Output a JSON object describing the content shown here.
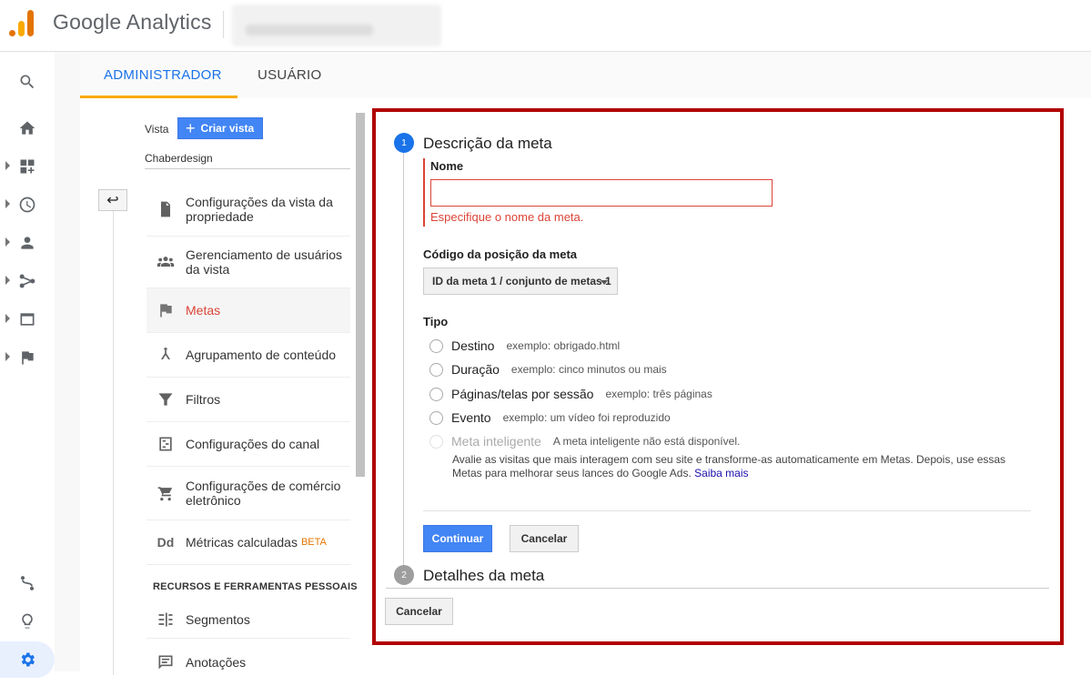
{
  "header": {
    "brand": "Google Analytics"
  },
  "rail": {
    "items": [
      "search-icon",
      "home-icon",
      "customization-icon",
      "realtime-icon",
      "audience-icon",
      "acquisition-icon",
      "behavior-icon",
      "conversions-icon",
      "attribution-icon",
      "discover-icon",
      "admin-icon"
    ]
  },
  "tabs": {
    "admin": "ADMINISTRADOR",
    "user": "USUÁRIO"
  },
  "admin_column": {
    "vista_label": "Vista",
    "criar_vista": "Criar vista",
    "view_name": "Chaberdesign",
    "menu": [
      {
        "label": "Configurações da vista da propriedade",
        "icon": "document-icon"
      },
      {
        "label": "Gerenciamento de usuários da vista",
        "icon": "users-icon"
      },
      {
        "label": "Metas",
        "icon": "flag-icon"
      },
      {
        "label": "Agrupamento de conteúdo",
        "icon": "content-grouping-icon"
      },
      {
        "label": "Filtros",
        "icon": "filter-icon"
      },
      {
        "label": "Configurações do canal",
        "icon": "channel-icon"
      },
      {
        "label": "Configurações de comércio eletrônico",
        "icon": "cart-icon"
      },
      {
        "label": "Métricas calculadas",
        "icon": "calculated-metrics-icon",
        "badge": "BETA"
      }
    ],
    "section_title": "RECURSOS E FERRAMENTAS PESSOAIS",
    "menu2": [
      {
        "label": "Segmentos",
        "icon": "segments-icon"
      },
      {
        "label": "Anotações",
        "icon": "annotations-icon"
      }
    ]
  },
  "goal": {
    "step1_number": "1",
    "step1_title": "Descrição da meta",
    "nome_label": "Nome",
    "nome_value": "",
    "nome_error": "Especifique o nome da meta.",
    "codigo_label": "Código da posição da meta",
    "codigo_value": "ID da meta 1 / conjunto de metas 1",
    "tipo_label": "Tipo",
    "types": [
      {
        "label": "Destino",
        "example": "exemplo: obrigado.html"
      },
      {
        "label": "Duração",
        "example": "exemplo: cinco minutos ou mais"
      },
      {
        "label": "Páginas/telas por sessão",
        "example": "exemplo: três páginas"
      },
      {
        "label": "Evento",
        "example": "exemplo: um vídeo foi reproduzido"
      },
      {
        "label": "Meta inteligente",
        "example": "A meta inteligente não está disponível."
      }
    ],
    "smart_desc": "Avalie as visitas que mais interagem com seu site e transforme-as automaticamente em Metas. Depois, use essas Metas para melhorar seus lances do Google Ads.",
    "smart_link": "Saiba mais",
    "continue_label": "Continuar",
    "cancel_label": "Cancelar",
    "step2_number": "2",
    "step2_title": "Detalhes da meta",
    "cancel_bottom_label": "Cancelar"
  },
  "colors": {
    "accent": "#1a73e8",
    "primary_button": "#4285f4",
    "error": "#db4437",
    "highlight_border": "#b00000",
    "tab_underline": "#f9ab00"
  }
}
